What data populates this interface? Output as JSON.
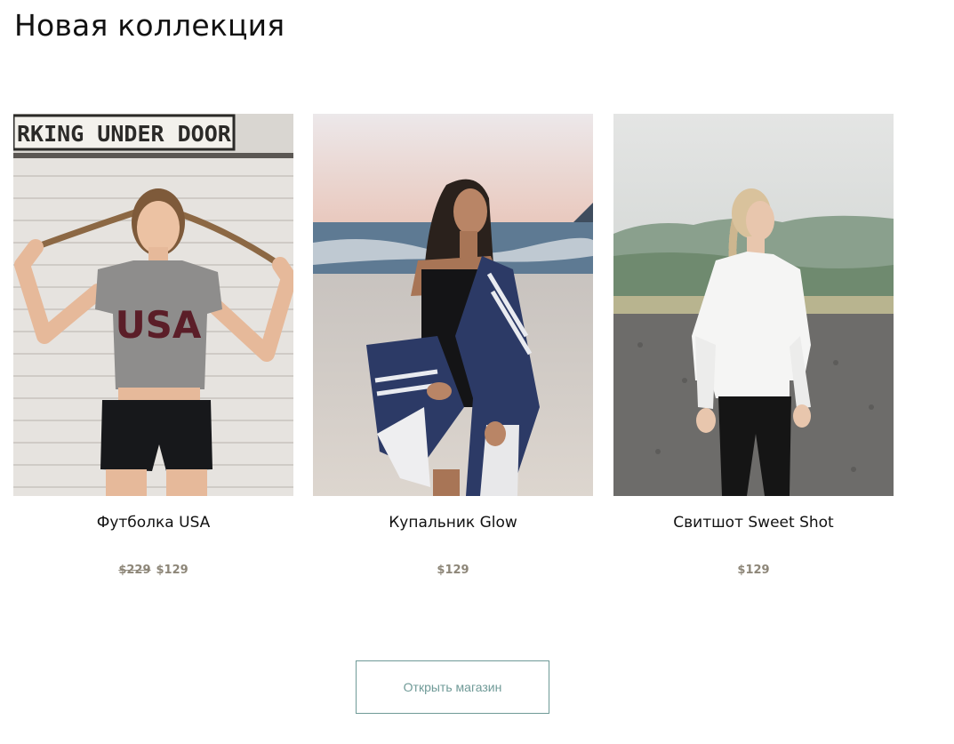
{
  "page": {
    "title": "Новая коллекция"
  },
  "products": [
    {
      "name": "Футболка USA",
      "price_old": "$229",
      "price": "$129",
      "image": {
        "sign_text": "RKING UNDER DOOR",
        "shirt_text": "USA"
      }
    },
    {
      "name": "Купальник Glow",
      "price_old": "",
      "price": "$129"
    },
    {
      "name": "Свитшот Sweet Shot",
      "price_old": "",
      "price": "$129"
    }
  ],
  "cta": {
    "label": "Открыть магазин"
  },
  "colors": {
    "text": "#111111",
    "price": "#8d8678",
    "button_border": "#6f9a97",
    "button_text": "#6f9a97"
  }
}
